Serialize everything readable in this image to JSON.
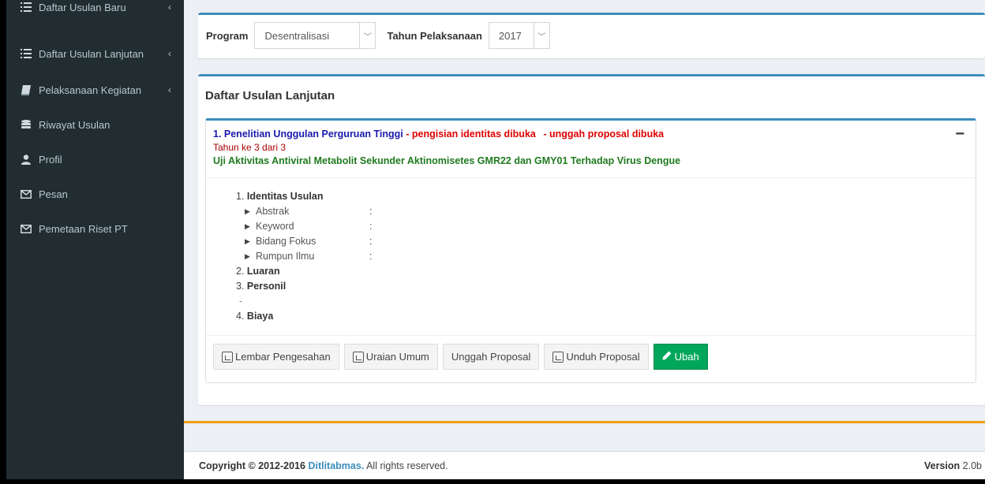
{
  "sidebar": {
    "items": [
      {
        "label": "Daftar Usulan Baru",
        "icon": "list-icon",
        "caret": "‹"
      },
      {
        "label": "Daftar Usulan Lanjutan",
        "icon": "list-icon",
        "caret": "‹"
      },
      {
        "label": "Pelaksanaan Kegiatan",
        "icon": "book-icon",
        "caret": "‹"
      },
      {
        "label": "Riwayat Usulan",
        "icon": "database-icon"
      },
      {
        "label": "Profil",
        "icon": "user-icon"
      },
      {
        "label": "Pesan",
        "icon": "envelope-icon"
      },
      {
        "label": "Pemetaan Riset PT",
        "icon": "envelope-icon"
      }
    ]
  },
  "filter": {
    "program_label": "Program",
    "program_value": "Desentralisasi",
    "tahun_label": "Tahun Pelaksanaan",
    "tahun_value": "2017"
  },
  "main": {
    "title": "Daftar Usulan Lanjutan",
    "panel": {
      "heading": "1. Penelitian Unggulan Perguruan Tinggi",
      "status_identitas": " - pengisian identitas dibuka",
      "status_proposal": " - unggah proposal dibuka",
      "tahun": "Tahun ke 3 dari 3",
      "judul": "Uji Aktivitas Antiviral Metabolit Sekunder Aktinomisetes GMR22 dan GMY01 Terhadap Virus Dengue",
      "collapse": "−",
      "sections": {
        "identitas_num": "1.",
        "identitas": "Identitas Usulan",
        "fields": [
          {
            "label": "Abstrak",
            "sep": ":"
          },
          {
            "label": "Keyword",
            "sep": ":"
          },
          {
            "label": "Bidang Fokus",
            "sep": ":"
          },
          {
            "label": "Rumpun Ilmu",
            "sep": ":"
          }
        ],
        "luaran_num": "2.",
        "luaran": "Luaran",
        "personil_num": "3.",
        "personil": "Personil",
        "personil_value": "-",
        "biaya_num": "4.",
        "biaya": "Biaya"
      },
      "buttons": {
        "lembar": "Lembar Pengesahan",
        "uraian": "Uraian Umum",
        "unggah": "Unggah Proposal",
        "unduh": "Unduh Proposal",
        "ubah": "Ubah"
      }
    }
  },
  "footer": {
    "copyright": "Copyright © 2012-2016 ",
    "brand": "Ditlitabmas.",
    "rights": " All rights reserved.",
    "version_label": "Version",
    "version_value": "2.0b"
  },
  "colors": {
    "sidebar_bg": "#222d32",
    "accent_blue": "#3c8dbc",
    "green": "#00a65a",
    "orange": "#f39c12"
  }
}
